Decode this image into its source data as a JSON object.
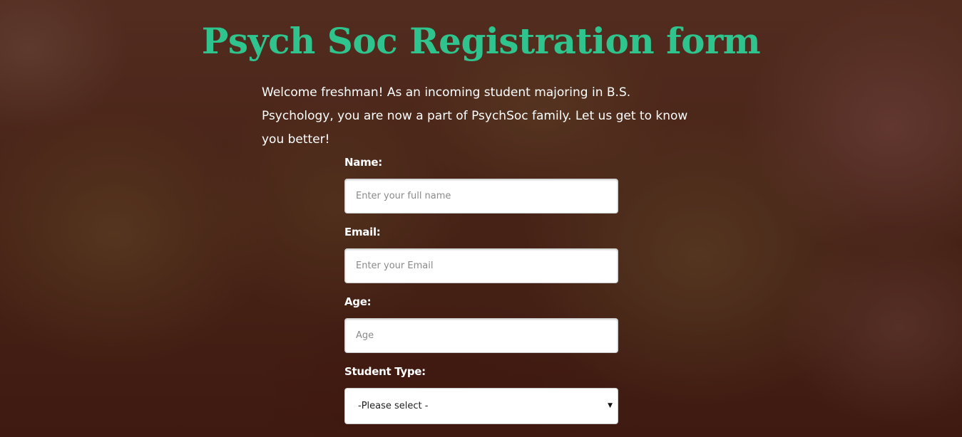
{
  "page": {
    "title": "Psych Soc Registration form",
    "intro": "Welcome freshman! As an incoming student majoring in B.S. Psychology, you are now a part of PsychSoc family. Let us get to know you better!"
  },
  "form": {
    "name": {
      "label": "Name:",
      "placeholder": "Enter your full name",
      "value": ""
    },
    "email": {
      "label": "Email:",
      "placeholder": "Enter your Email",
      "value": ""
    },
    "age": {
      "label": "Age:",
      "placeholder": "Age",
      "value": ""
    },
    "student_type": {
      "label": "Student Type:",
      "selected": "-Please select -",
      "arrow_icon": "triangle-down-icon"
    }
  },
  "colors": {
    "title": "#2fc48d",
    "text": "#ffffff",
    "overlay": "#46140c"
  }
}
